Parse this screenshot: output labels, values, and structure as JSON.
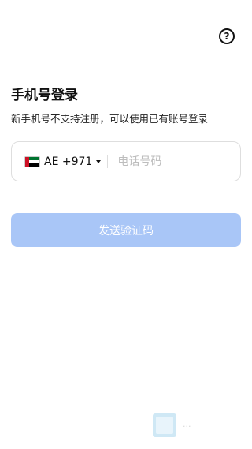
{
  "header": {
    "help_icon": "question-circle-icon",
    "help_glyph": "?"
  },
  "login": {
    "title": "手机号登录",
    "subtitle": "新手机号不支持注册，可以使用已有账号登录"
  },
  "phone": {
    "country_code": "AE +971",
    "flag": "uae-flag-icon",
    "placeholder": "电话号码",
    "value": ""
  },
  "actions": {
    "send_code_label": "发送验证码",
    "send_code_color": "#a9c6f7"
  }
}
